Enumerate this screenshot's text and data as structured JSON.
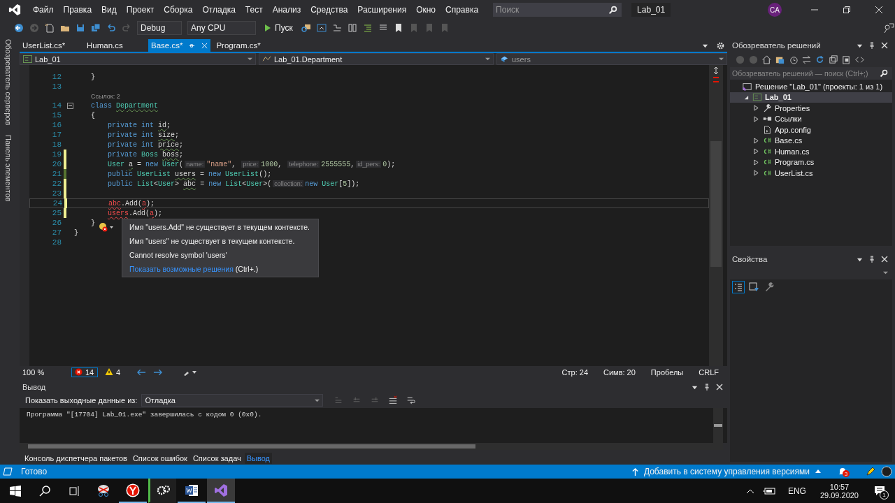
{
  "menu": [
    "Файл",
    "Правка",
    "Вид",
    "Проект",
    "Сборка",
    "Отладка",
    "Тест",
    "Анализ",
    "Средства",
    "Расширения",
    "Окно",
    "Справка"
  ],
  "search": {
    "placeholder": "Поиск"
  },
  "solution_name": "Lab_01",
  "account": {
    "initials": "CA"
  },
  "toolbar": {
    "configuration": "Debug",
    "platform": "Any CPU",
    "run": "Пуск"
  },
  "side_tabs": [
    "Обозреватель серверов",
    "Панель элементов"
  ],
  "tabs": [
    {
      "label": "UserList.cs*",
      "selected": false
    },
    {
      "label": "Human.cs",
      "selected": false
    },
    {
      "label": "Base.cs*",
      "selected": true
    },
    {
      "label": "Program.cs*",
      "selected": false
    }
  ],
  "nav": {
    "project": "Lab_01",
    "type": "Lab_01.Department",
    "member": "users"
  },
  "code": {
    "lines": [
      {
        "kind": "code",
        "n": "12",
        "modified": false,
        "saved": false,
        "current": false,
        "fold": false,
        "tokens": [
          {
            "t": "    }",
            "kind": "plain"
          }
        ]
      },
      {
        "kind": "code",
        "n": "13",
        "modified": false,
        "saved": false,
        "current": false,
        "fold": false
      },
      {
        "kind": "lens",
        "text": "Ссылок: 2"
      },
      {
        "kind": "code",
        "n": "14",
        "modified": false,
        "saved": false,
        "current": false,
        "fold": true,
        "tokens": [
          {
            "t": "    class ",
            "kind": "kw"
          },
          {
            "t": "Department",
            "kind": "type",
            "warning": true
          }
        ]
      },
      {
        "kind": "code",
        "n": "15",
        "modified": false,
        "saved": false,
        "current": false,
        "fold": false,
        "tokens": [
          {
            "t": "    {",
            "kind": "plain"
          }
        ]
      },
      {
        "kind": "code",
        "n": "16",
        "modified": false,
        "saved": false,
        "current": false,
        "fold": false,
        "tokens": [
          {
            "t": "        private int ",
            "kind": "kw"
          },
          {
            "t": "id",
            "kind": "plain",
            "warning": true
          },
          {
            "t": ";",
            "kind": "plain"
          }
        ]
      },
      {
        "kind": "code",
        "n": "17",
        "modified": false,
        "saved": false,
        "current": false,
        "fold": false,
        "tokens": [
          {
            "t": "        private int ",
            "kind": "kw"
          },
          {
            "t": "size",
            "kind": "plain",
            "warning": true
          },
          {
            "t": ";",
            "kind": "plain"
          }
        ]
      },
      {
        "kind": "code",
        "n": "18",
        "modified": false,
        "saved": false,
        "current": false,
        "fold": false,
        "tokens": [
          {
            "t": "        private int ",
            "kind": "kw"
          },
          {
            "t": "price",
            "kind": "plain",
            "warning": true
          },
          {
            "t": ";",
            "kind": "plain"
          }
        ]
      },
      {
        "kind": "code",
        "n": "19",
        "modified": true,
        "saved": false,
        "current": false,
        "fold": false,
        "tokens": [
          {
            "t": "        private ",
            "kind": "kw"
          },
          {
            "t": "Boss ",
            "kind": "type"
          },
          {
            "t": "boss",
            "kind": "plain",
            "warning": true
          },
          {
            "t": ";",
            "kind": "plain"
          }
        ]
      },
      {
        "kind": "code",
        "n": "20",
        "modified": true,
        "saved": false,
        "current": false,
        "fold": false,
        "tokens": [
          {
            "t": "        User ",
            "kind": "type"
          },
          {
            "t": "a",
            "kind": "plain",
            "warning": true
          },
          {
            "t": " = ",
            "kind": "plain"
          },
          {
            "t": "new ",
            "kind": "kw"
          },
          {
            "t": "User",
            "kind": "type"
          },
          {
            "t": "(",
            "kind": "plain"
          },
          {
            "t": "name:",
            "kind": "hint"
          },
          {
            "t": "\"name\"",
            "kind": "str"
          },
          {
            "t": ", ",
            "kind": "plain"
          },
          {
            "t": "price:",
            "kind": "hint"
          },
          {
            "t": "1000",
            "kind": "num"
          },
          {
            "t": ", ",
            "kind": "plain"
          },
          {
            "t": "telephone:",
            "kind": "hint"
          },
          {
            "t": "2555555",
            "kind": "num"
          },
          {
            "t": ",",
            "kind": "plain"
          },
          {
            "t": "id_pers:",
            "kind": "hint"
          },
          {
            "t": "0",
            "kind": "num"
          },
          {
            "t": ");",
            "kind": "plain"
          }
        ]
      },
      {
        "kind": "code",
        "n": "21",
        "modified": true,
        "saved": true,
        "current": false,
        "fold": false,
        "tokens": [
          {
            "t": "        public ",
            "kind": "kw"
          },
          {
            "t": "UserList ",
            "kind": "type"
          },
          {
            "t": "users",
            "kind": "plain",
            "warning": true
          },
          {
            "t": " = ",
            "kind": "plain"
          },
          {
            "t": "new ",
            "kind": "kw"
          },
          {
            "t": "UserList",
            "kind": "type"
          },
          {
            "t": "();",
            "kind": "plain"
          }
        ]
      },
      {
        "kind": "code",
        "n": "22",
        "modified": true,
        "saved": false,
        "current": false,
        "fold": false,
        "tokens": [
          {
            "t": "        public ",
            "kind": "kw"
          },
          {
            "t": "List",
            "kind": "type"
          },
          {
            "t": "<",
            "kind": "plain"
          },
          {
            "t": "User",
            "kind": "type"
          },
          {
            "t": "> ",
            "kind": "plain"
          },
          {
            "t": "abc",
            "kind": "plain",
            "warning": true
          },
          {
            "t": " = ",
            "kind": "plain"
          },
          {
            "t": "new ",
            "kind": "kw"
          },
          {
            "t": "List",
            "kind": "type"
          },
          {
            "t": "<",
            "kind": "plain"
          },
          {
            "t": "User",
            "kind": "type"
          },
          {
            "t": ">(",
            "kind": "plain"
          },
          {
            "t": "collection:",
            "kind": "hint"
          },
          {
            "t": "new ",
            "kind": "kw"
          },
          {
            "t": "User",
            "kind": "type"
          },
          {
            "t": "[",
            "kind": "plain"
          },
          {
            "t": "5",
            "kind": "num"
          },
          {
            "t": "]);",
            "kind": "plain"
          }
        ]
      },
      {
        "kind": "code",
        "n": "23",
        "modified": true,
        "saved": false,
        "current": false,
        "fold": false
      },
      {
        "kind": "code",
        "n": "24",
        "modified": true,
        "saved": false,
        "current": true,
        "fold": false,
        "tokens": [
          {
            "t": "        abc",
            "kind": "plain",
            "error": true
          },
          {
            "t": ".Add(",
            "kind": "plain"
          },
          {
            "t": "a",
            "kind": "plain",
            "error": true
          },
          {
            "t": ");",
            "kind": "plain"
          }
        ]
      },
      {
        "kind": "code",
        "n": "25",
        "modified": true,
        "saved": false,
        "current": false,
        "fold": false,
        "tokens": [
          {
            "t": "        users",
            "kind": "plain",
            "error": true
          },
          {
            "t": ".Add(",
            "kind": "plain"
          },
          {
            "t": "a",
            "kind": "plain",
            "error": true
          },
          {
            "t": ");",
            "kind": "plain"
          }
        ]
      },
      {
        "kind": "code",
        "n": "26",
        "modified": false,
        "saved": false,
        "current": false,
        "fold": false,
        "tokens": [
          {
            "t": "    }",
            "kind": "plain"
          }
        ]
      },
      {
        "kind": "code",
        "n": "27",
        "modified": false,
        "saved": false,
        "current": false,
        "fold": false,
        "tokens": [
          {
            "t": "}",
            "kind": "plain"
          }
        ]
      },
      {
        "kind": "code",
        "n": "28",
        "modified": false,
        "saved": false,
        "current": false,
        "fold": false
      }
    ]
  },
  "tooltip": {
    "messages": [
      "Имя \"users.Add\" не существует в текущем контексте.",
      "Имя \"users\" не существует в текущем контексте.",
      "Cannot resolve symbol 'users'"
    ],
    "link": "Показать возможные решения",
    "shortcut": "(Ctrl+.)"
  },
  "editor_status": {
    "zoom": "100 %",
    "errors": "14",
    "warnings": "4",
    "line": "Стр: 24",
    "column": "Симв: 20",
    "whitespace": "Пробелы",
    "line_ending": "CRLF"
  },
  "output": {
    "title": "Вывод",
    "source_label": "Показать выходные данные из:",
    "source": "Отладка",
    "text": "Программа \"[17704] Lab_01.exe\" завершилась с кодом 0 (0x0)."
  },
  "bottom_tabs": [
    {
      "label": "Консоль диспетчера пакетов",
      "selected": false
    },
    {
      "label": "Список ошибок",
      "selected": false
    },
    {
      "label": "Список задач",
      "selected": false
    },
    {
      "label": "Вывод",
      "selected": true
    }
  ],
  "solution_explorer": {
    "title": "Обозреватель решений",
    "search_placeholder": "Обозреватель решений — поиск (Ctrl+;)",
    "tree": [
      {
        "label": "Решение \"Lab_01\" (проекты: 1 из 1)",
        "kind": "solution",
        "selected": false,
        "children": [
          {
            "label": "Lab_01",
            "kind": "project",
            "selected": true,
            "expanded": true,
            "children": [
              {
                "label": "Properties",
                "kind": "properties",
                "selected": false,
                "expanded": false
              },
              {
                "label": "Ссылки",
                "kind": "references",
                "selected": false,
                "expanded": false
              },
              {
                "label": "App.config",
                "kind": "config",
                "selected": false
              },
              {
                "label": "Base.cs",
                "kind": "csharp",
                "selected": false,
                "expanded": false
              },
              {
                "label": "Human.cs",
                "kind": "csharp",
                "selected": false,
                "expanded": false
              },
              {
                "label": "Program.cs",
                "kind": "csharp",
                "selected": false,
                "expanded": false
              },
              {
                "label": "UserList.cs",
                "kind": "csharp",
                "selected": false,
                "expanded": false
              }
            ]
          }
        ]
      }
    ]
  },
  "properties": {
    "title": "Свойства"
  },
  "status_bar": {
    "text": "Готово",
    "source_control": "Добавить в систему управления версиями",
    "notifications": "3"
  },
  "taskbar": {
    "language": "ENG",
    "time": "10:57",
    "date": "29.09.2020",
    "notifications": "1"
  }
}
